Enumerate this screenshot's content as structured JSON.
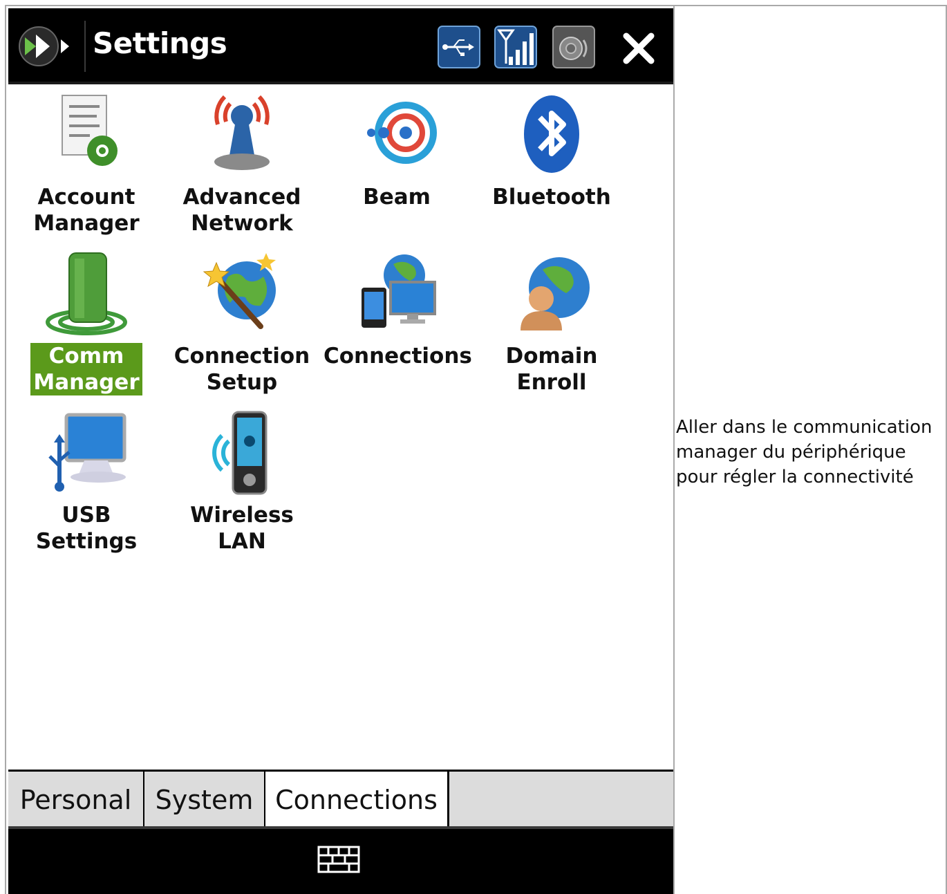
{
  "titlebar": {
    "title": "Settings",
    "status_icons": [
      "usb-connection-icon",
      "signal-strength-icon",
      "speaker-icon"
    ],
    "close_glyph": "✕"
  },
  "settings_items": [
    {
      "label": "Account\nManager",
      "icon": "account-manager-icon"
    },
    {
      "label": "Advanced\nNetwork",
      "icon": "advanced-network-icon"
    },
    {
      "label": "Beam",
      "icon": "beam-icon"
    },
    {
      "label": "Bluetooth",
      "icon": "bluetooth-icon"
    },
    {
      "label": "Comm\nManager",
      "icon": "comm-manager-icon",
      "selected": true
    },
    {
      "label": "Connection\nSetup",
      "icon": "connection-setup-icon"
    },
    {
      "label": "Connections",
      "icon": "connections-icon"
    },
    {
      "label": "Domain\nEnroll",
      "icon": "domain-enroll-icon"
    },
    {
      "label": "USB Settings",
      "icon": "usb-settings-icon"
    },
    {
      "label": "Wireless LAN",
      "icon": "wireless-lan-icon"
    }
  ],
  "tabs": [
    {
      "label": "Personal"
    },
    {
      "label": "System"
    },
    {
      "label": "Connections",
      "active": true
    }
  ],
  "bottombar": {
    "icon": "keyboard-icon"
  },
  "note": "Aller dans le communication manager du périphérique pour régler la connectivité",
  "colors": {
    "selection": "#5b9a1b",
    "titlebar": "#000000"
  }
}
